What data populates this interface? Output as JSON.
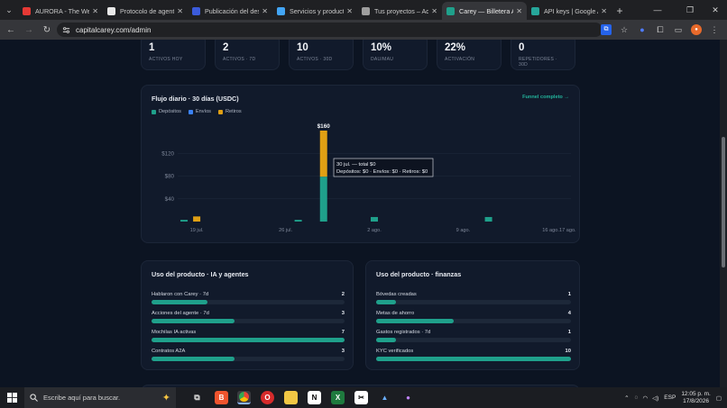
{
  "browser": {
    "tabs": [
      {
        "title": "AURORA - The Weig",
        "color": "#e53935",
        "active": false
      },
      {
        "title": "Protocolo de agente",
        "color": "#e8e8e8",
        "active": false
      },
      {
        "title": "Publicación del desa",
        "color": "#3b5bdb",
        "active": false
      },
      {
        "title": "Servicios y producto",
        "color": "#42a5f5",
        "active": false
      },
      {
        "title": "Tus proyectos – Adm",
        "color": "#9e9e9e",
        "active": false
      },
      {
        "title": "Carey — Billetera Au",
        "color": "#1fa08b",
        "active": true
      },
      {
        "title": "API keys | Google AI",
        "color": "#26a69a",
        "active": false
      }
    ],
    "url": "capitalcarey.com/admin"
  },
  "stats": [
    {
      "value": "1",
      "label": "ACTIVOS HOY"
    },
    {
      "value": "2",
      "label": "ACTIVOS · 7D"
    },
    {
      "value": "10",
      "label": "ACTIVOS · 30D"
    },
    {
      "value": "10%",
      "label": "DAU/MAU"
    },
    {
      "value": "22%",
      "label": "ACTIVACIÓN"
    },
    {
      "value": "0",
      "label": "REPETIDORES · 30D"
    }
  ],
  "chart_section": {
    "title": "Flujo diario · 30 días (USDC)",
    "link": "Funnel completo →",
    "tooltip_line1": "30 jul. — total $0",
    "tooltip_line2": "Depósitos: $0 · Envíos: $0 · Retiros: $0",
    "peak_label": "$160"
  },
  "chart_data": {
    "type": "bar",
    "stacked": true,
    "legend": [
      "Depósitos",
      "Envíos",
      "Retiros"
    ],
    "colors": {
      "Depósitos": "#1fa08b",
      "Envíos": "#3b82f6",
      "Retiros": "#e0a014"
    },
    "y_ticks": [
      "$40",
      "$80",
      "$120"
    ],
    "x_ticks": [
      "19 jul.",
      "26 jul.",
      "2 ago.",
      "9 ago.",
      "16 ago.",
      "17 ago."
    ],
    "ylim": [
      0,
      160
    ],
    "bars": [
      {
        "date": "18 jul.",
        "Depósitos": 3,
        "Envíos": 0,
        "Retiros": 0
      },
      {
        "date": "19 jul.",
        "Depósitos": 0,
        "Envíos": 0,
        "Retiros": 9
      },
      {
        "date": "27 jul.",
        "Depósitos": 3,
        "Envíos": 0,
        "Retiros": 0
      },
      {
        "date": "29 jul.",
        "Depósitos": 79,
        "Envíos": 0,
        "Retiros": 81
      },
      {
        "date": "2 ago.",
        "Depósitos": 8,
        "Envíos": 0,
        "Retiros": 0
      },
      {
        "date": "11 ago.",
        "Depósitos": 8,
        "Envíos": 0,
        "Retiros": 0
      }
    ]
  },
  "usage_ai": {
    "title": "Uso del producto · IA y agentes",
    "rows": [
      {
        "label": "Hablaron con Carey · 7d",
        "value": "2",
        "fraction": 0.29
      },
      {
        "label": "Acciones del agente · 7d",
        "value": "3",
        "fraction": 0.43
      },
      {
        "label": "Mochilas IA activas",
        "value": "7",
        "fraction": 1.0
      },
      {
        "label": "Contratos A2A",
        "value": "3",
        "fraction": 0.43
      }
    ]
  },
  "usage_fin": {
    "title": "Uso del producto · finanzas",
    "rows": [
      {
        "label": "Bóvedas creadas",
        "value": "1",
        "fraction": 0.1
      },
      {
        "label": "Metas de ahorro",
        "value": "4",
        "fraction": 0.4
      },
      {
        "label": "Gastos registrados · 7d",
        "value": "1",
        "fraction": 0.1
      },
      {
        "label": "KYC verificados",
        "value": "10",
        "fraction": 1.0
      }
    ]
  },
  "taskbar": {
    "search_placeholder": "Escribe aquí para buscar.",
    "language": "ESP",
    "time": "12:05 p. m.",
    "date": "17/8/2026"
  }
}
